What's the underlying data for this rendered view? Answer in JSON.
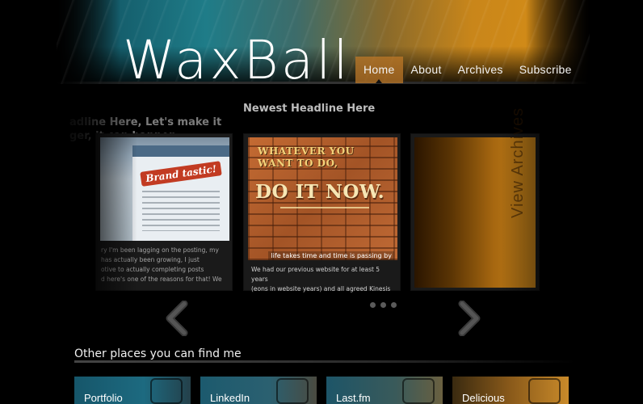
{
  "site": {
    "logo": "WaxBall"
  },
  "nav": {
    "items": [
      {
        "label": "Home",
        "active": true
      },
      {
        "label": "About",
        "active": false
      },
      {
        "label": "Archives",
        "active": false
      },
      {
        "label": "Subscribe",
        "active": false
      }
    ]
  },
  "slider": {
    "posts": [
      {
        "headline": "adline Here, Let's make it\nger, it can happen",
        "excerpt": "ry I'm been lagging on the posting, my\nhas actually been growing, I just\notive to actually completing posts\nd here's one of the reasons for that! We",
        "image": {
          "badge": "Brand tastic!"
        }
      },
      {
        "headline": "Newest Headline Here",
        "excerpt": "We had our previous website for at least 5 years\n(eons in website years) and all agreed Kinesis",
        "image": {
          "top_text": "WHATEVER YOU\nWANT TO DO,",
          "main_text": "DO IT NOW.",
          "foot_text": "life takes time and time is passing by"
        }
      }
    ],
    "archive_card": {
      "label": "View Archives"
    },
    "pager": {
      "prev": "‹",
      "next": "›",
      "dots": 3
    }
  },
  "other_places": {
    "title": "Other places you can find me",
    "tiles": [
      {
        "label": "Portfolio"
      },
      {
        "label": "LinkedIn"
      },
      {
        "label": "Last.fm"
      },
      {
        "label": "Delicious"
      }
    ]
  },
  "colors": {
    "background": "#000000",
    "nav_active": "#be7828",
    "accent_teal": "#1f7c88",
    "accent_orange": "#c9861a"
  }
}
